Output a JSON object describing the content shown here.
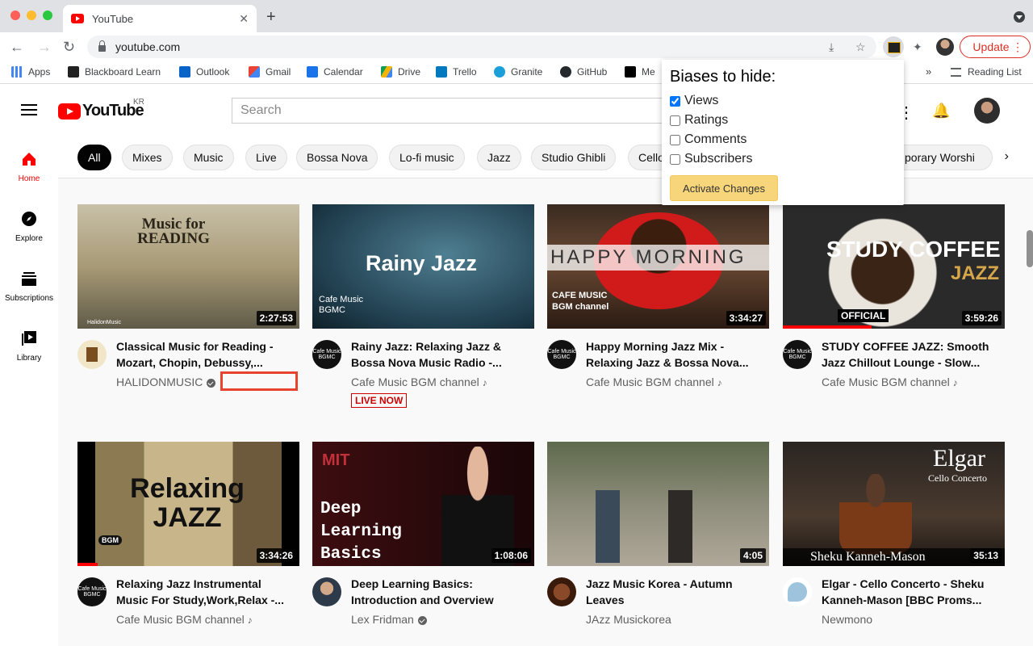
{
  "browser": {
    "tab_title": "YouTube",
    "tab_close": "✕",
    "new_tab": "+",
    "url": "youtube.com",
    "update_label": "Update",
    "bookmarks": [
      "Apps",
      "Blackboard Learn",
      "Outlook",
      "Gmail",
      "Calendar",
      "Drive",
      "Trello",
      "Granite",
      "GitHub",
      "Me"
    ],
    "bookmark_overflow": "»",
    "reading_list": "Reading List"
  },
  "youtube": {
    "logo_text": "YouTube",
    "region": "KR",
    "search_placeholder": "Search",
    "chips": [
      "All",
      "Mixes",
      "Music",
      "Live",
      "Bossa Nova",
      "Lo-fi music",
      "Jazz",
      "Studio Ghibli",
      "Cello",
      "porary Worshi"
    ],
    "chip_next": "›",
    "sidebar": [
      {
        "label": "Home",
        "icon": "home-icon"
      },
      {
        "label": "Explore",
        "icon": "compass-icon"
      },
      {
        "label": "Subscriptions",
        "icon": "subscriptions-icon"
      },
      {
        "label": "Library",
        "icon": "library-icon"
      }
    ],
    "videos": [
      {
        "title": "Classical Music for Reading - Mozart, Chopin, Debussy,...",
        "channel": "HALIDONMUSIC",
        "duration": "2:27:53",
        "thumb_text": "Music for READING",
        "thumb_sub": "HalidonMusic"
      },
      {
        "title": "Rainy Jazz: Relaxing Jazz & Bossa Nova Music Radio -...",
        "channel": "Cafe Music BGM channel",
        "badge": "LIVE NOW",
        "thumb_text": "Rainy Jazz",
        "thumb_sub": "Cafe Music BGMC"
      },
      {
        "title": "Happy Morning Jazz Mix - Relaxing Jazz & Bossa Nova...",
        "channel": "Cafe Music BGM channel",
        "duration": "3:34:27",
        "thumb_text": "HAPPY MORNING",
        "thumb_sub": "CAFE MUSIC BGM channel"
      },
      {
        "title": "STUDY COFFEE JAZZ: Smooth Jazz Chillout Lounge - Slow...",
        "channel": "Cafe Music BGM channel",
        "duration": "3:59:26",
        "thumb_text": "STUDY COFFEE",
        "thumb_sub": "JAZZ",
        "thumb_tag": "OFFICIAL"
      },
      {
        "title": "Relaxing Jazz Instrumental Music For Study,Work,Relax -...",
        "channel": "Cafe Music BGM channel",
        "duration": "3:34:26",
        "thumb_text": "Relaxing JAZZ",
        "thumb_sub": "BGM"
      },
      {
        "title": "Deep Learning Basics: Introduction and Overview",
        "channel": "Lex Fridman",
        "duration": "1:08:06",
        "thumb_text": "Deep Learning Basics",
        "thumb_sub": "MIT"
      },
      {
        "title": "Jazz Music Korea - Autumn Leaves",
        "channel": "JAzz Musickorea",
        "duration": "4:05"
      },
      {
        "title": "Elgar - Cello Concerto - Sheku Kanneh-Mason [BBC Proms...",
        "channel": "Newmono",
        "duration": "35:13",
        "thumb_text": "Elgar",
        "thumb_sub": "Cello Concerto",
        "thumb_caption": "Sheku Kanneh-Mason"
      }
    ],
    "music_note": "♪",
    "channel_avatar_text": "Cafe Music BGMC"
  },
  "extension_popup": {
    "heading": "Biases to hide:",
    "options": [
      {
        "label": "Views",
        "checked": true
      },
      {
        "label": "Ratings",
        "checked": false
      },
      {
        "label": "Comments",
        "checked": false
      },
      {
        "label": "Subscribers",
        "checked": false
      }
    ],
    "button": "Activate Changes"
  },
  "colors": {
    "youtube_red": "#ff0000",
    "live_red": "#cc0000",
    "highlight": "#e8432c",
    "button_yellow": "#f7d57a"
  }
}
